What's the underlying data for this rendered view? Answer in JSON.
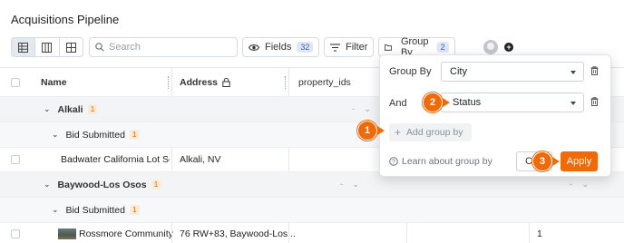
{
  "page": {
    "title": "Acquisitions Pipeline"
  },
  "toolbar": {
    "search_placeholder": "Search",
    "fields_label": "Fields",
    "fields_count": "32",
    "filter_label": "Filter",
    "groupby_label": "Group By",
    "groupby_count": "2"
  },
  "table": {
    "columns": [
      "Name",
      "Address",
      "property_ids"
    ],
    "groups": [
      {
        "name": "Alkali",
        "count": "1",
        "subgroup": "Bid Submitted",
        "sub_count": "1",
        "row_name": "Badwater California Lot Servic",
        "row_address": "Alkali, NV"
      },
      {
        "name": "Baywood-Los Osos",
        "count": "1",
        "subgroup": "Bid Submitted",
        "sub_count": "1",
        "row_name": "Rossmore Community",
        "row_address": "76 RW+83, Baywood-Los...",
        "row_extra": "1"
      }
    ]
  },
  "popover": {
    "rows": [
      {
        "label": "Group By",
        "value": "City"
      },
      {
        "label": "And",
        "value": "Status"
      }
    ],
    "add_group_label": "Add group by",
    "learn_label": "Learn about group by",
    "cancel_label": "C",
    "apply_label": "Apply"
  },
  "steps": [
    "1",
    "2",
    "3"
  ],
  "colors": {
    "accent": "#ef6a0b",
    "badge_bg": "#fdebd5"
  }
}
